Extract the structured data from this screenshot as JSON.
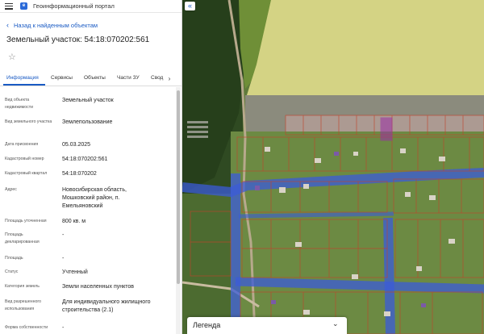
{
  "app": {
    "title": "Геоинформационный портал"
  },
  "nav": {
    "back_label": "Назад к найденным объектам"
  },
  "page": {
    "title": "Земельный участок: 54:18:070202:561"
  },
  "tabs": [
    {
      "label": "Информация",
      "active": true
    },
    {
      "label": "Сервисы",
      "active": false
    },
    {
      "label": "Объекты",
      "active": false
    },
    {
      "label": "Части ЗУ",
      "active": false
    },
    {
      "label": "Свод",
      "active": false
    }
  ],
  "attributes": [
    {
      "label": "Вид объекта недвижимости",
      "value": "Земельный участок"
    },
    {
      "label": "Вид земельного участка",
      "value": "Землепользование"
    },
    {
      "label": "Дата присвоения",
      "value": "05.03.2025"
    },
    {
      "label": "Кадастровый номер",
      "value": "54:18:070202:561"
    },
    {
      "label": "Кадастровый квартал",
      "value": "54:18:070202"
    },
    {
      "label": "Адрес",
      "value": "Новосибирская область, Мошковский район, п. Емельяновский"
    },
    {
      "label": "Площадь уточненная",
      "value": "800 кв. м"
    },
    {
      "label": "Площадь декларированная",
      "value": "-"
    },
    {
      "label": "Площадь",
      "value": "-"
    },
    {
      "label": "Статус",
      "value": "Учтенный"
    },
    {
      "label": "Категория земель",
      "value": "Земли населенных пунктов"
    },
    {
      "label": "Вид разрешенного использования",
      "value": "Для индивидуального жилищного строительства (2.1)"
    },
    {
      "label": "Форма собственности",
      "value": "-"
    }
  ],
  "legend": {
    "title": "Легенда"
  },
  "icons": {
    "menu": "burger-menu-icon",
    "logo": "portal-logo-icon",
    "back": "chevron-left-icon",
    "favorite": "star-outline-icon",
    "tabs_next": "chevron-right-icon",
    "collapse": "double-chevron-left-icon",
    "legend_toggle": "chevron-down-icon"
  },
  "colors": {
    "accent": "#1a5bc4",
    "parcel_border": "#c0452c",
    "selected_parcel": "#9b2ea6",
    "road_overlay": "#3b5bd8",
    "field_zone": "#e3df8a"
  }
}
